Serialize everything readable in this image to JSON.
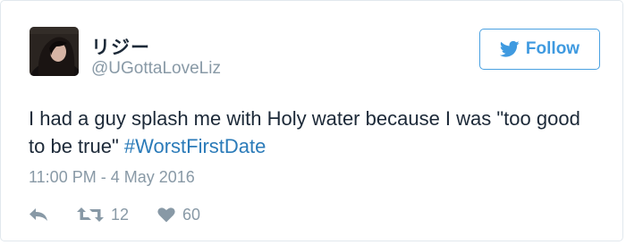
{
  "user": {
    "display_name": "リジー",
    "handle": "@UGottaLoveLiz"
  },
  "follow_button": {
    "label": "Follow"
  },
  "tweet": {
    "text": "I had a guy splash me with Holy water because I was \"too good to be true\" ",
    "hashtag": "#WorstFirstDate",
    "timestamp": "11:00 PM - 4 May 2016"
  },
  "actions": {
    "retweets": "12",
    "likes": "60"
  },
  "colors": {
    "accent": "#1da1f2",
    "link": "#2b7bb9",
    "muted": "#8899a6",
    "text": "#1c2938"
  },
  "icons": [
    "avatar-photo",
    "twitter-bird-icon",
    "reply-icon",
    "retweet-icon",
    "heart-icon"
  ]
}
